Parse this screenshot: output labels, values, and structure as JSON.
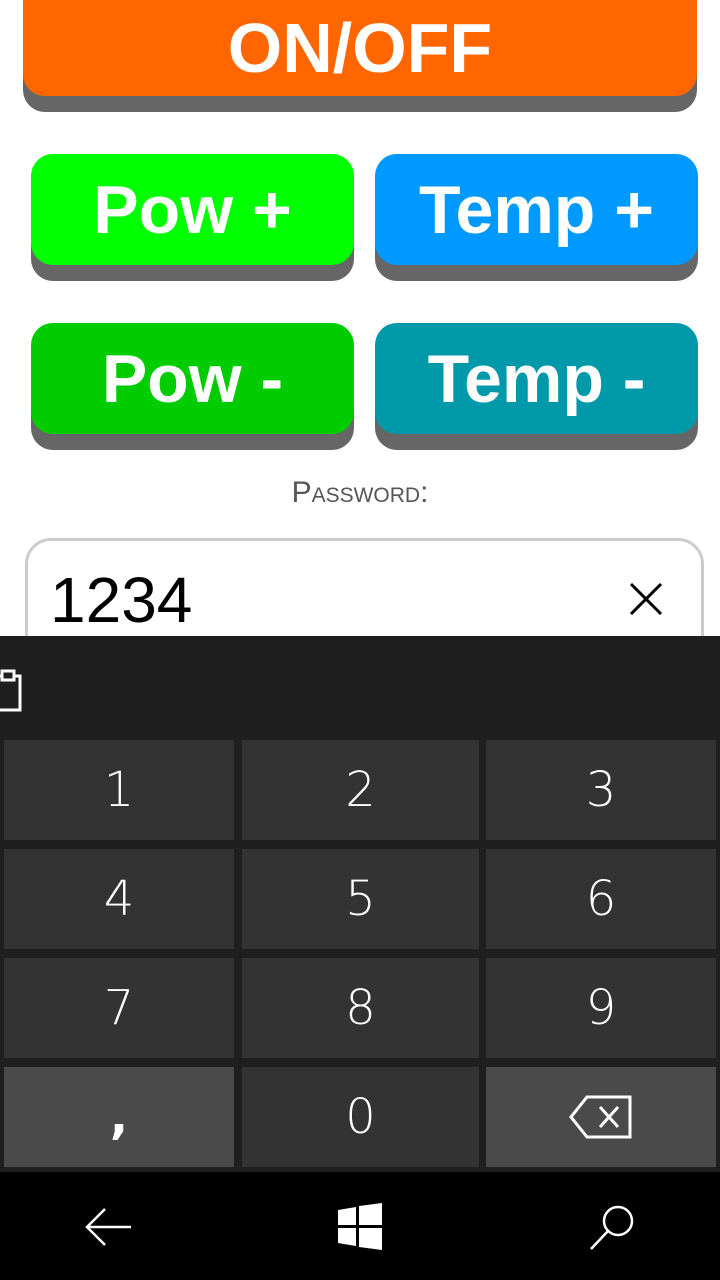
{
  "buttons": {
    "onoff": "ON/OFF",
    "pow_plus": "Pow +",
    "temp_plus": "Temp +",
    "pow_minus": "Pow -",
    "temp_minus": "Temp -"
  },
  "password": {
    "label": "Password:",
    "value": "1234"
  },
  "keyboard": {
    "keys": [
      "1",
      "2",
      "3",
      "4",
      "5",
      "6",
      "7",
      "8",
      "9",
      ",",
      "0"
    ]
  },
  "icons": {
    "clear": "close-icon",
    "clipboard": "clipboard-icon",
    "backspace": "backspace-icon",
    "back": "back-arrow-icon",
    "home": "windows-icon",
    "search": "search-icon"
  },
  "colors": {
    "onoff": "#ff6600",
    "pow_plus": "#00ff00",
    "temp_plus": "#0099ff",
    "pow_minus": "#00cc00",
    "temp_minus": "#0099aa",
    "button_shadow": "#666666",
    "keyboard_bg": "#1f1f1f",
    "key_bg": "#333333"
  }
}
